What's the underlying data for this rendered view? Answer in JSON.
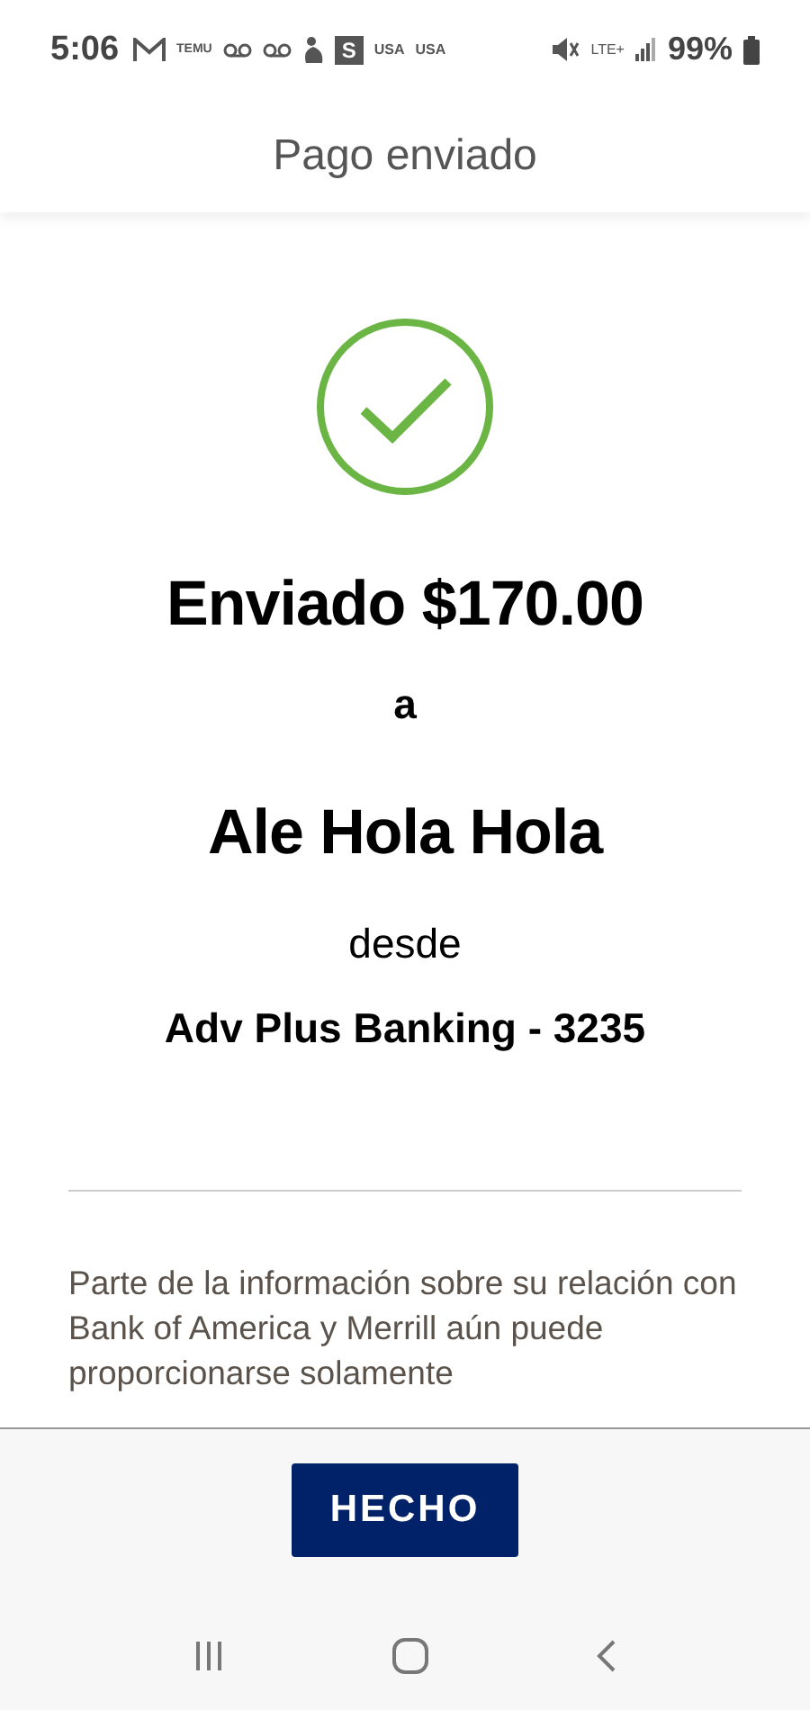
{
  "status_bar": {
    "time": "5:06",
    "notification_texts": [
      "TEMU",
      "S",
      "USA",
      "USA"
    ],
    "network": "LTE+",
    "battery": "99%"
  },
  "header": {
    "title": "Pago enviado"
  },
  "confirmation": {
    "amount_line": "Enviado $170.00",
    "to_word": "a",
    "recipient": "Ale Hola Hola",
    "from_word": "desde",
    "account": "Adv Plus Banking - 3235"
  },
  "disclaimer": "Parte de la información sobre su relación con Bank of America y Merrill aún puede proporcionarse solamente",
  "footer": {
    "button": "HECHO"
  }
}
